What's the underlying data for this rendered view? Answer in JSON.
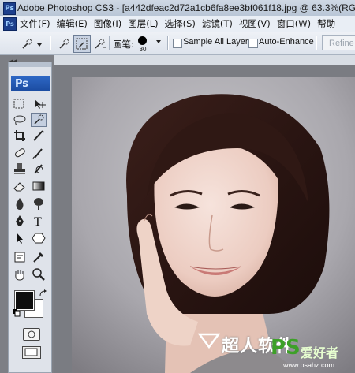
{
  "window": {
    "title": "Adobe Photoshop CS3 - [a442dfeac2d72a1cb6fa8ee3bf061f18.jpg @ 63.3%(RGB",
    "app_icon": "Ps"
  },
  "menu": {
    "items": [
      "文件(F)",
      "编辑(E)",
      "图像(I)",
      "图层(L)",
      "选择(S)",
      "滤镜(T)",
      "视图(V)",
      "窗口(W)",
      "帮助"
    ]
  },
  "options_bar": {
    "brush_label": "画笔:",
    "brush_size": "30",
    "sample_all_layers_label": "Sample All Layers",
    "sample_all_layers_checked": false,
    "auto_enhance_label": "Auto-Enhance",
    "auto_enhance_checked": false,
    "refine_label": "Refine"
  },
  "toolbox": {
    "logo": "Ps",
    "collapse_arrows": "◂◂",
    "foreground_color": "#0e0e0e",
    "background_color": "#ffffff"
  },
  "watermark": {
    "brand_text": "超人软件",
    "ps_text": "PS",
    "ps_sub": "爱好者",
    "url": "www.psahz.com"
  }
}
